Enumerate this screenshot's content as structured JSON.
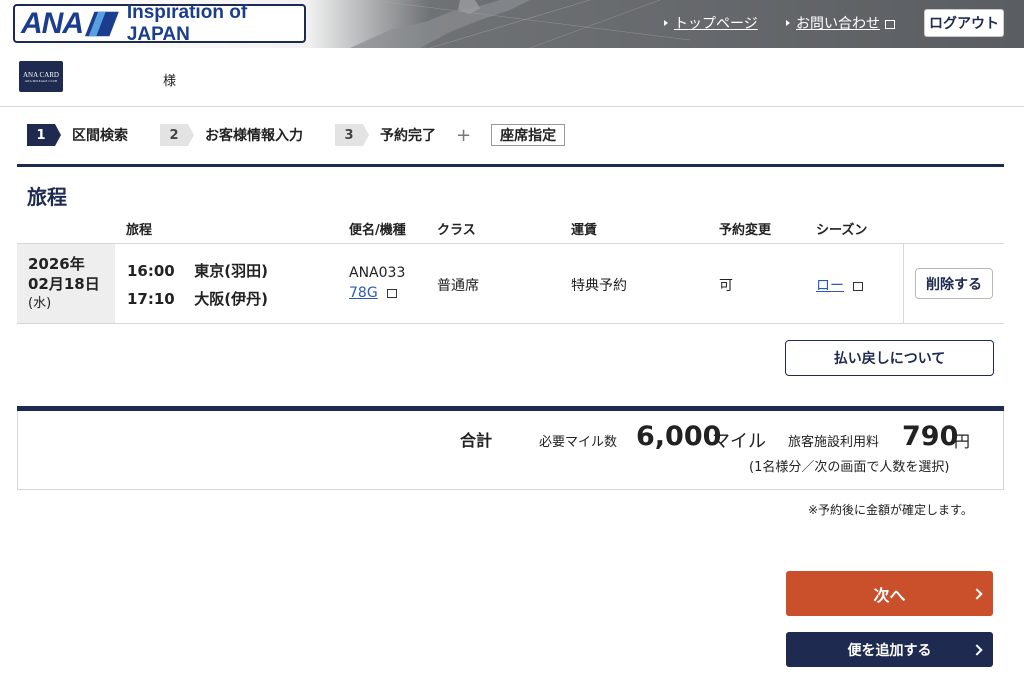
{
  "header": {
    "logo_text": "ANA",
    "tagline": "Inspiration of JAPAN",
    "top_page_link": "トップページ",
    "contact_link": "お問い合わせ",
    "logout_label": "ログアウト"
  },
  "user": {
    "card_text": "ANA CARD",
    "card_subtext": "ANA MILEAGE CLUB",
    "honorific": "様"
  },
  "steps": [
    {
      "num": "1",
      "label": "区間検索"
    },
    {
      "num": "2",
      "label": "お客様情報入力"
    },
    {
      "num": "3",
      "label": "予約完了"
    }
  ],
  "steps_plus": "+",
  "seat_label": "座席指定",
  "section_title": "旅程",
  "table": {
    "headers": {
      "itinerary": "旅程",
      "flight": "便名/機種",
      "class": "クラス",
      "fare": "運賃",
      "change": "予約変更",
      "season": "シーズン"
    },
    "row": {
      "date_line1": "2026年",
      "date_line2": "02月18日",
      "weekday": "(水)",
      "dep_time": "16:00",
      "dep_airport": "東京(羽田)",
      "arr_time": "17:10",
      "arr_airport": "大阪(伊丹)",
      "flight_no": "ANA033",
      "aircraft": "78G",
      "class": "普通席",
      "fare": "特典予約",
      "change": "可",
      "season": "ロー",
      "delete_label": "削除する"
    }
  },
  "refund_label": "払い戻しについて",
  "total": {
    "label": "合計",
    "miles_label": "必要マイル数",
    "miles_value": "6,000",
    "miles_unit": "マイル",
    "fee_label": "旅客施設利用料",
    "fee_value": "790",
    "fee_unit": "円",
    "fee_note": "(1名様分／次の画面で人数を選択)"
  },
  "confirm_note": "※予約後に金額が確定します。",
  "next_label": "次へ",
  "add_flight_label": "便を追加する",
  "colors": {
    "navy": "#1e2a4f",
    "orange": "#c9502a",
    "link": "#2a5db0"
  }
}
